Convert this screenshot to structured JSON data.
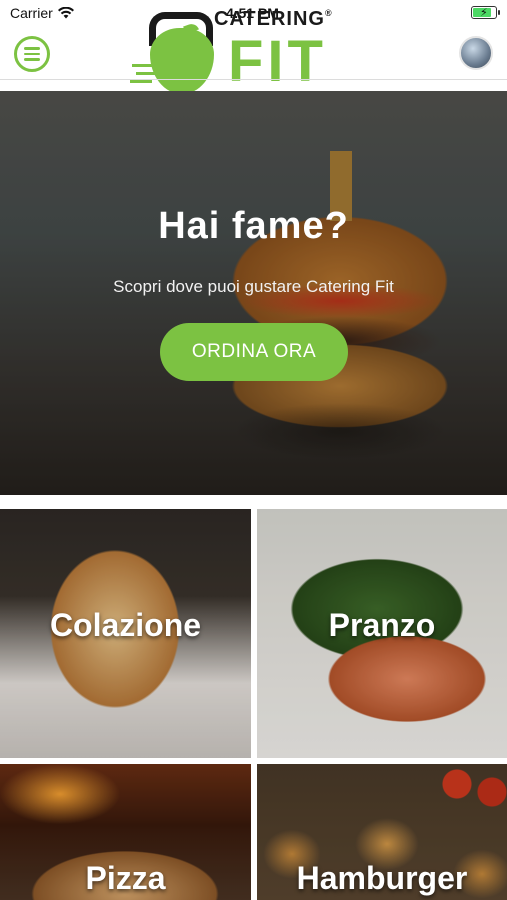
{
  "status_bar": {
    "carrier": "Carrier",
    "time": "4:51 PM"
  },
  "header": {
    "logo_top": "CATERING",
    "logo_reg": "®",
    "logo_main": "FIT"
  },
  "hero": {
    "title": "Hai fame?",
    "subtitle": "Scopri dove puoi gustare Catering Fit",
    "cta_label": "ORDINA ORA"
  },
  "categories": [
    {
      "label": "Colazione"
    },
    {
      "label": "Pranzo"
    },
    {
      "label": "Pizza"
    },
    {
      "label": "Hamburger"
    }
  ],
  "colors": {
    "brand_green": "#7cc242",
    "logo_dark": "#1a1a1a"
  },
  "icons": {
    "menu": "hamburger-menu-icon",
    "wifi": "wifi-icon",
    "battery": "battery-charging-icon",
    "avatar": "user-avatar"
  }
}
